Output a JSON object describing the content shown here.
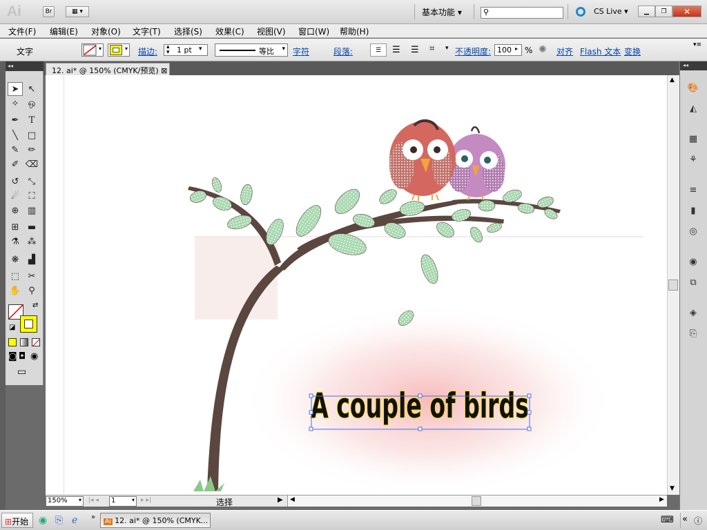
{
  "app": {
    "logo": "Ai",
    "bridge": "Br",
    "workspace": "基本功能",
    "search_placeholder": "",
    "cslive": "CS Live"
  },
  "menu": [
    "文件(F)",
    "编辑(E)",
    "对象(O)",
    "文字(T)",
    "选择(S)",
    "效果(C)",
    "视图(V)",
    "窗口(W)",
    "帮助(H)"
  ],
  "control": {
    "label": "文字",
    "stroke_label": "描边:",
    "stroke_value": "1 pt",
    "profile": "等比",
    "char_link": "字符",
    "para_label": "段落:",
    "opacity_label": "不透明度:",
    "opacity_value": "100",
    "pct": "%",
    "align_link": "对齐",
    "flash_link": "Flash 文本",
    "transform_link": "变换"
  },
  "doc": {
    "tab": "12. ai* @ 150% (CMYK/预览)",
    "close": "⊠"
  },
  "canvas": {
    "text": "A couple of birds"
  },
  "status": {
    "zoom": "150%",
    "page": "1",
    "mode": "选择"
  },
  "taskbar": {
    "start": "开始",
    "task": "12. ai* @ 150% (CMYK..."
  },
  "colors": {
    "accent": "#0645ad",
    "trunk": "#5b4640",
    "leaf": "#a8d8b0",
    "bird1": "#d4685f",
    "bird2": "#c48bc2"
  }
}
